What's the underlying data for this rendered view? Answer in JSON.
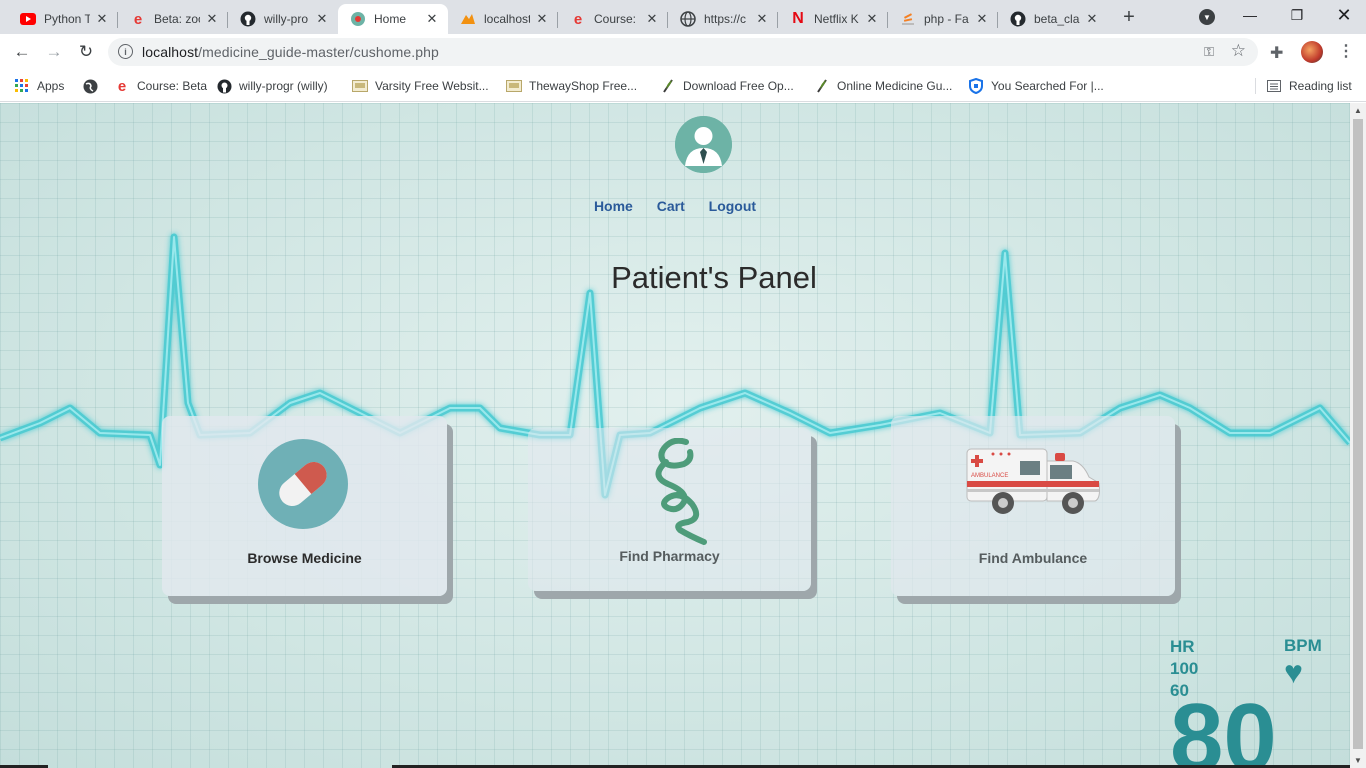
{
  "browser": {
    "tabs": [
      {
        "title": "Python T",
        "icon": "youtube-icon"
      },
      {
        "title": "Beta: zoo",
        "icon": "e-icon"
      },
      {
        "title": "willy-pro",
        "icon": "github-icon"
      },
      {
        "title": "Home",
        "icon": "site-icon"
      },
      {
        "title": "localhost",
        "icon": "pma-icon"
      },
      {
        "title": "Course: B",
        "icon": "e-icon"
      },
      {
        "title": "https://c",
        "icon": "globe-icon"
      },
      {
        "title": "Netflix K",
        "icon": "netflix-icon"
      },
      {
        "title": "php - Fa",
        "icon": "stack-icon"
      },
      {
        "title": "beta_cla",
        "icon": "github-icon"
      }
    ],
    "url_host": "localhost",
    "url_path": "/medicine_guide-master/cushome.php",
    "bookmarks": [
      {
        "label": "Apps",
        "icon": "apps-grid-icon"
      },
      {
        "label": "",
        "icon": "globe-icon"
      },
      {
        "label": "Course: Beta",
        "icon": "e-icon"
      },
      {
        "label": "willy-progr (willy)",
        "icon": "github-icon"
      },
      {
        "label": "Varsity Free Websit...",
        "icon": "image-icon"
      },
      {
        "label": "ThewayShop Free...",
        "icon": "image-icon"
      },
      {
        "label": "Download Free Op...",
        "icon": "leaf-icon"
      },
      {
        "label": "Online Medicine Gu...",
        "icon": "leaf-icon"
      },
      {
        "label": "You Searched For |...",
        "icon": "shield-icon"
      }
    ],
    "reading_list": "Reading list"
  },
  "page": {
    "nav": {
      "home": "Home",
      "cart": "Cart",
      "logout": "Logout"
    },
    "title": "Patient's Panel",
    "cards": [
      {
        "label": "Browse Medicine",
        "icon": "pill-icon"
      },
      {
        "label": "Find Pharmacy",
        "icon": "caduceus-icon"
      },
      {
        "label": "Find Ambulance",
        "icon": "ambulance-icon"
      }
    ],
    "monitor": {
      "hr": "HR",
      "hr_high": "100",
      "hr_low": "60",
      "bpm": "BPM",
      "value": "80"
    },
    "ambulance_text": "AMBULANCE"
  },
  "colors": {
    "accent_nav": "#2a5a9a",
    "ecg": "#3fc6cf",
    "monitor": "#2a8e93"
  }
}
